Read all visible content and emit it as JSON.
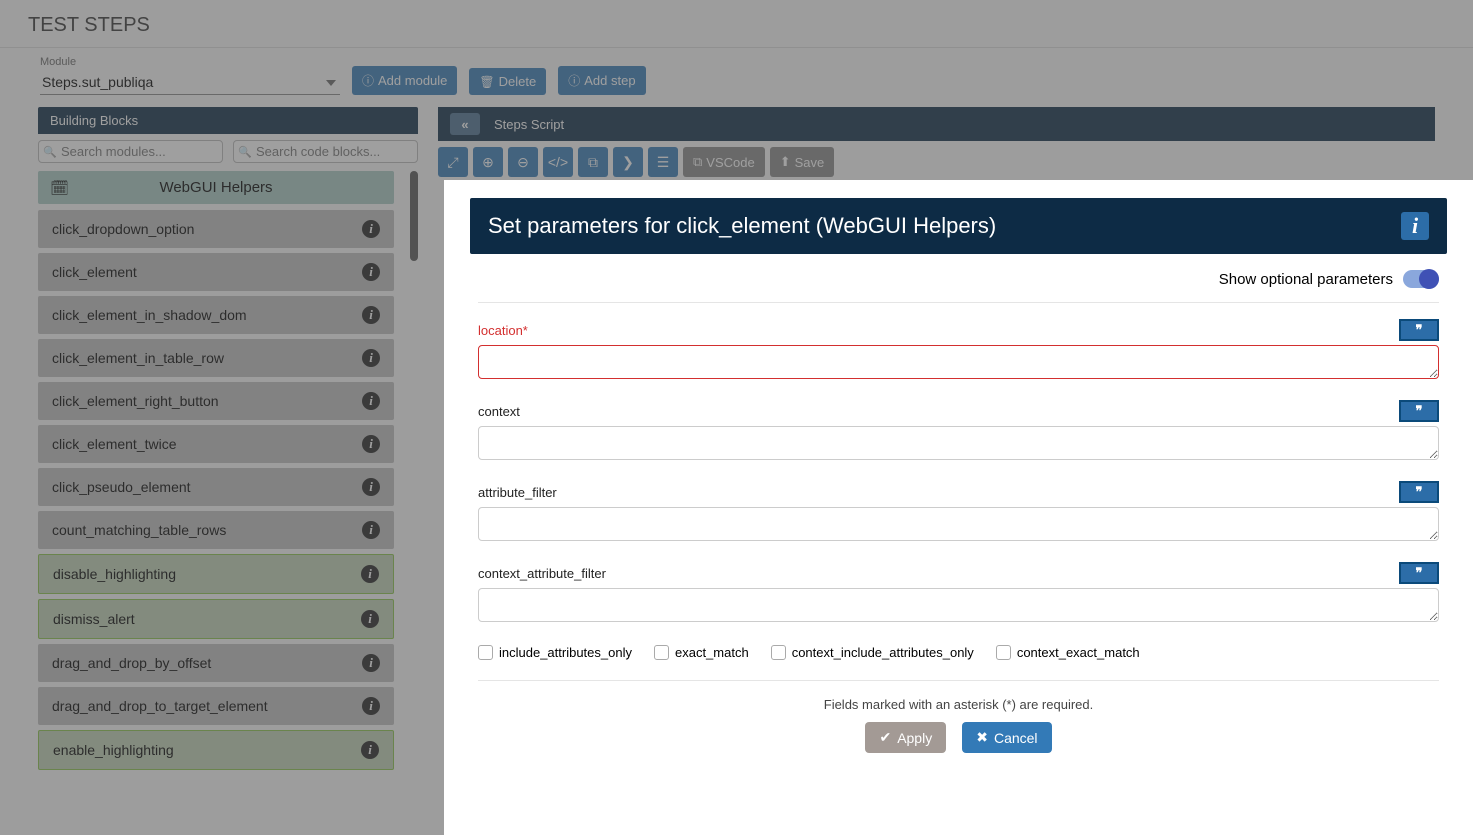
{
  "page_title": "TEST STEPS",
  "module": {
    "label": "Module",
    "value": "Steps.sut_publiqa"
  },
  "actions": {
    "add_module": "Add module",
    "delete": "Delete",
    "add_step": "Add step"
  },
  "building_blocks": {
    "header": "Building Blocks",
    "search_modules_ph": "Search modules...",
    "search_code_ph": "Search code blocks...",
    "category": "WebGUI Helpers",
    "items": [
      {
        "label": "click_dropdown_option",
        "green": false
      },
      {
        "label": "click_element",
        "green": false
      },
      {
        "label": "click_element_in_shadow_dom",
        "green": false
      },
      {
        "label": "click_element_in_table_row",
        "green": false
      },
      {
        "label": "click_element_right_button",
        "green": false
      },
      {
        "label": "click_element_twice",
        "green": false
      },
      {
        "label": "click_pseudo_element",
        "green": false
      },
      {
        "label": "count_matching_table_rows",
        "green": false
      },
      {
        "label": "disable_highlighting",
        "green": true
      },
      {
        "label": "dismiss_alert",
        "green": true
      },
      {
        "label": "drag_and_drop_by_offset",
        "green": false
      },
      {
        "label": "drag_and_drop_to_target_element",
        "green": false
      },
      {
        "label": "enable_highlighting",
        "green": true
      }
    ]
  },
  "script": {
    "header": "Steps Script",
    "vscode": "VSCode",
    "save": "Save"
  },
  "modal": {
    "title": "Set parameters for click_element (WebGUI Helpers)",
    "show_optional": "Show optional parameters",
    "params": [
      {
        "key": "location",
        "label": "location*",
        "required": true
      },
      {
        "key": "context",
        "label": "context",
        "required": false
      },
      {
        "key": "attribute_filter",
        "label": "attribute_filter",
        "required": false
      },
      {
        "key": "context_attribute_filter",
        "label": "context_attribute_filter",
        "required": false
      }
    ],
    "checks": [
      "include_attributes_only",
      "exact_match",
      "context_include_attributes_only",
      "context_exact_match"
    ],
    "footer_note": "Fields marked with an asterisk (*) are required.",
    "apply": "Apply",
    "cancel": "Cancel"
  }
}
